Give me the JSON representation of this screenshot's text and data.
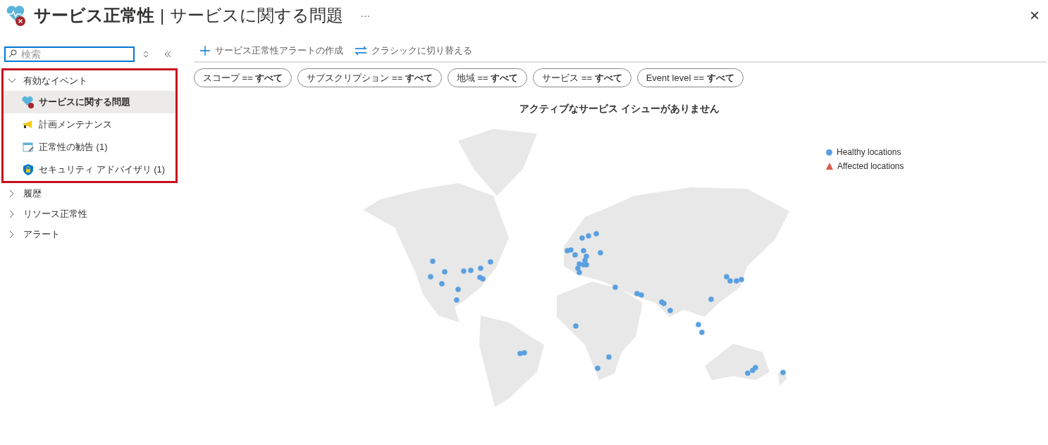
{
  "header": {
    "title": "サービス正常性",
    "separator": "|",
    "subtitle": "サービスに関する問題",
    "more": "···",
    "close": "×"
  },
  "sidebar": {
    "search": {
      "placeholder": "検索"
    },
    "groups": [
      {
        "label": "有効なイベント",
        "expanded": true,
        "highlighted": true,
        "children": [
          {
            "label": "サービスに関する問題",
            "selected": true
          },
          {
            "label": "計画メンテナンス",
            "selected": false
          },
          {
            "label": "正常性の勧告 (1)",
            "selected": false
          },
          {
            "label": "セキュリティ アドバイザリ (1)",
            "selected": false
          }
        ]
      },
      {
        "label": "履歴",
        "expanded": false,
        "highlighted": false
      },
      {
        "label": "リソース正常性",
        "expanded": false,
        "highlighted": false
      },
      {
        "label": "アラート",
        "expanded": false,
        "highlighted": false
      }
    ]
  },
  "toolbar": [
    {
      "label": "サービス正常性アラートの作成"
    },
    {
      "label": "クラシックに切り替える"
    }
  ],
  "filters": [
    "スコープ == **すべて**",
    "サブスクリプション == **すべて**",
    "地域 == **すべて**",
    "サービス == **すべて**",
    "Event level == **すべて**"
  ],
  "map": {
    "title": "アクティブなサービス イシューがありません",
    "legend": [
      {
        "label": "Healthy locations",
        "color": "#5aa0e0"
      },
      {
        "label": "Affected locations",
        "color": "#e05a4a"
      }
    ]
  }
}
